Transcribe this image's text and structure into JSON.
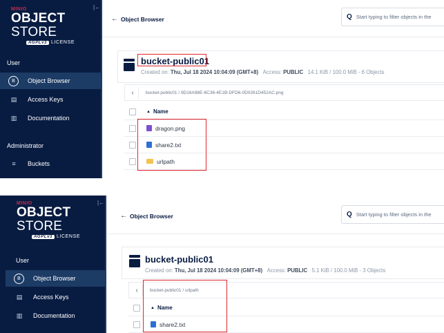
{
  "brand": {
    "minio": "MINIO",
    "object": "OBJECT",
    "store": "STORE",
    "agpl": "AGPLv3",
    "license": "LICENSE"
  },
  "sidebar": {
    "user_label": "User",
    "admin_label": "Administrator",
    "items": [
      {
        "label": "Object Browser",
        "icon": "bucket-circle-icon"
      },
      {
        "label": "Access Keys",
        "icon": "key-icon"
      },
      {
        "label": "Documentation",
        "icon": "document-icon"
      },
      {
        "label": "Buckets",
        "icon": "buckets-icon"
      }
    ]
  },
  "header": {
    "back_label": "Object Browser",
    "filter_placeholder": "Start typing to filter objects in the"
  },
  "top": {
    "bucket_name": "bucket-public01",
    "created_label": "Created on:",
    "created_value": "Thu, Jul 18 2024 10:04:09 (GMT+8)",
    "access_label": "Access:",
    "access_value": "PUBLIC",
    "usage": "14.1 KiB / 100.0 MiB - 6 Objects",
    "path": "bucket-public01 / 9D16A98E-6C36-4E1B-DFD6-0D0261D452AC.png",
    "column_name": "Name",
    "rows": [
      {
        "name": "dragon.png",
        "type": "image"
      },
      {
        "name": "share2.txt",
        "type": "text"
      },
      {
        "name": "urlpath",
        "type": "folder"
      }
    ]
  },
  "bottom": {
    "bucket_name": "bucket-public01",
    "created_label": "Created on:",
    "created_value": "Thu, Jul 18 2024 10:04:09 (GMT+8)",
    "access_label": "Access:",
    "access_value": "PUBLIC",
    "usage": "5.1 KiB / 100.0 MiB - 3 Objects",
    "path": "bucket-public01 / urlpath",
    "column_name": "Name",
    "rows": [
      {
        "name": "share2.txt",
        "type": "text"
      }
    ]
  },
  "colors": {
    "sidebar_bg": "#081c42",
    "active_item": "#1c3b65",
    "highlight": "#e0262d"
  }
}
